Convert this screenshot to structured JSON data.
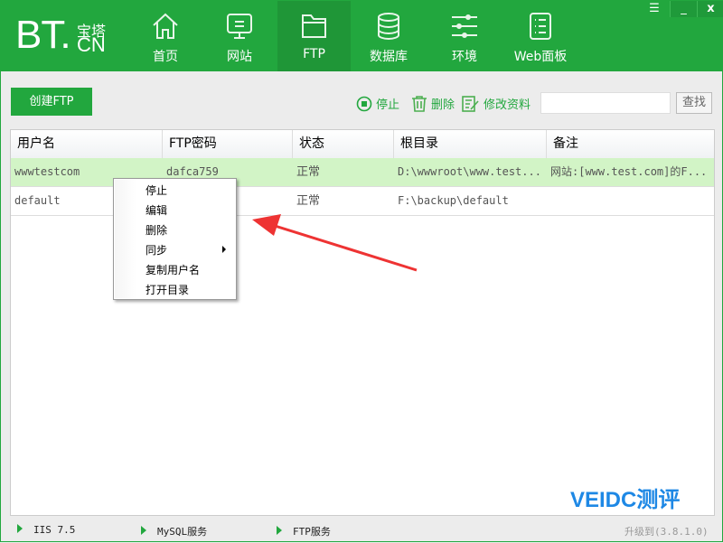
{
  "logo": {
    "bt": "BT.",
    "bao": "宝塔",
    "cn": "CN"
  },
  "nav": [
    {
      "label": "首页",
      "icon": "home-icon"
    },
    {
      "label": "网站",
      "icon": "monitor-icon"
    },
    {
      "label": "FTP",
      "icon": "folder-icon"
    },
    {
      "label": "数据库",
      "icon": "database-icon"
    },
    {
      "label": "环境",
      "icon": "sliders-icon"
    },
    {
      "label": "Web面板",
      "icon": "list-icon"
    }
  ],
  "window": {
    "menu": "☰",
    "minimize": "_",
    "close": "x"
  },
  "toolbar": {
    "create": "创建FTP",
    "stop": "停止",
    "delete": "删除",
    "edit": "修改资料",
    "search_value": "",
    "find": "查找"
  },
  "table": {
    "headers": [
      "用户名",
      "FTP密码",
      "状态",
      "根目录",
      "备注"
    ],
    "rows": [
      [
        "wwwtestcom",
        "dafca759",
        "正常",
        "D:\\wwwroot\\www.test...",
        "网站:[www.test.com]的F..."
      ],
      [
        "default",
        "",
        "正常",
        "F:\\backup\\default",
        ""
      ]
    ]
  },
  "context_menu": [
    "停止",
    "编辑",
    "删除",
    "同步",
    "复制用户名",
    "打开目录"
  ],
  "status": {
    "iis": "IIS 7.5",
    "mysql": "MySQL服务",
    "ftp": "FTP服务",
    "upgrade": "升级到(3.8.1.0)"
  },
  "watermark": "VEIDC测评"
}
